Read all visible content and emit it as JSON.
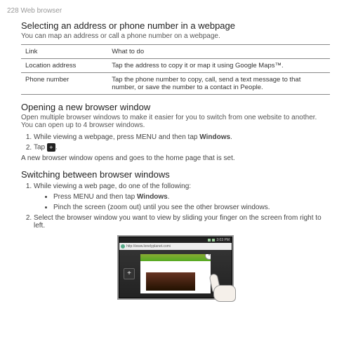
{
  "page_header": "228  Web browser",
  "section1": {
    "title": "Selecting an address or phone number in a webpage",
    "intro": "You can map an address or call a phone number on a webpage.",
    "table": {
      "col1": "Link",
      "col2": "What to do",
      "rows": [
        {
          "link": "Location address",
          "desc": "Tap the address to copy it or map it using Google Maps™."
        },
        {
          "link": "Phone number",
          "desc": "Tap the phone number to copy, call, send a text message to that number, or save the number to a contact in People."
        }
      ]
    }
  },
  "section2": {
    "title": "Opening a new browser window",
    "intro": "Open multiple browser windows to make it easier for you to switch from one website to another. You can open up to 4 browser windows.",
    "step1_before": "While viewing a webpage, press MENU and then tap ",
    "step1_bold": "Windows",
    "step1_after": ".",
    "step2_before": "Tap ",
    "step2_after": ".",
    "followup": "A new browser window opens and goes to the home page that is set."
  },
  "section3": {
    "title": "Switching between browser windows",
    "step1": "While viewing a web page, do one of the following:",
    "bullet1_before": "Press MENU and then tap ",
    "bullet1_bold": "Windows",
    "bullet1_after": ".",
    "bullet2": "Pinch the screen (zoom out) until you see the other browser windows.",
    "step2": "Select the browser window you want to view by sliding your finger on the screen from right to left."
  },
  "screenshot": {
    "time": "3:03 PM",
    "url": "http://www.lonelyplanet.com/",
    "plus": "+",
    "close": "×"
  }
}
